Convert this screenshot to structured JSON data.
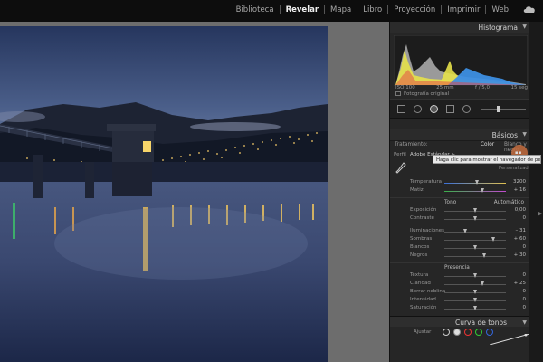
{
  "topbar": {
    "modules": [
      {
        "label": "Biblioteca",
        "active": false
      },
      {
        "label": "Revelar",
        "active": true
      },
      {
        "label": "Mapa",
        "active": false
      },
      {
        "label": "Libro",
        "active": false
      },
      {
        "label": "Proyección",
        "active": false
      },
      {
        "label": "Imprimir",
        "active": false
      },
      {
        "label": "Web",
        "active": false
      }
    ]
  },
  "histogram": {
    "title": "Histograma",
    "iso": "ISO 100",
    "focal": "25 mm",
    "aperture": "f / 5,0",
    "shutter": "15 seg",
    "original_label": "Fotografía original"
  },
  "basicos": {
    "title": "Básicos",
    "tratamiento_label": "Tratamiento:",
    "color_label": "Color",
    "bw_label": "Blanco y negro",
    "perfil_label": "Perfil",
    "perfil_value": "Adobe Estándar ÷",
    "tooltip": "Haga clic para mostrar el navegador de perfiles.",
    "wb_label": "B: Personalizado",
    "sliders_wb": [
      {
        "label": "Temperatura",
        "value": "3200",
        "pos": 0.54
      },
      {
        "label": "Matiz",
        "value": "+ 16",
        "pos": 0.62
      }
    ],
    "tono_label": "Tono",
    "auto_label": "Automático",
    "sliders_tono1": [
      {
        "label": "Exposición",
        "value": "0,00",
        "pos": 0.5
      },
      {
        "label": "Contraste",
        "value": "0",
        "pos": 0.5
      }
    ],
    "sliders_tono2": [
      {
        "label": "Iluminaciones",
        "value": "– 31",
        "pos": 0.34
      },
      {
        "label": "Sombras",
        "value": "+ 60",
        "pos": 0.8
      },
      {
        "label": "Blancos",
        "value": "0",
        "pos": 0.5
      },
      {
        "label": "Negros",
        "value": "+ 30",
        "pos": 0.65
      }
    ],
    "presencia_label": "Presencia",
    "sliders_presencia": [
      {
        "label": "Textura",
        "value": "0",
        "pos": 0.5
      },
      {
        "label": "Claridad",
        "value": "+ 25",
        "pos": 0.63
      },
      {
        "label": "Borrar neblina",
        "value": "0",
        "pos": 0.5
      },
      {
        "label": "Intensidad",
        "value": "0",
        "pos": 0.5
      },
      {
        "label": "Saturación",
        "value": "0",
        "pos": 0.5
      }
    ]
  },
  "curva": {
    "title": "Curva de tonos",
    "ajustar_label": "Ajustar"
  },
  "colors": {
    "profile_button": "#c46d3f",
    "panel_bg": "#262626"
  }
}
